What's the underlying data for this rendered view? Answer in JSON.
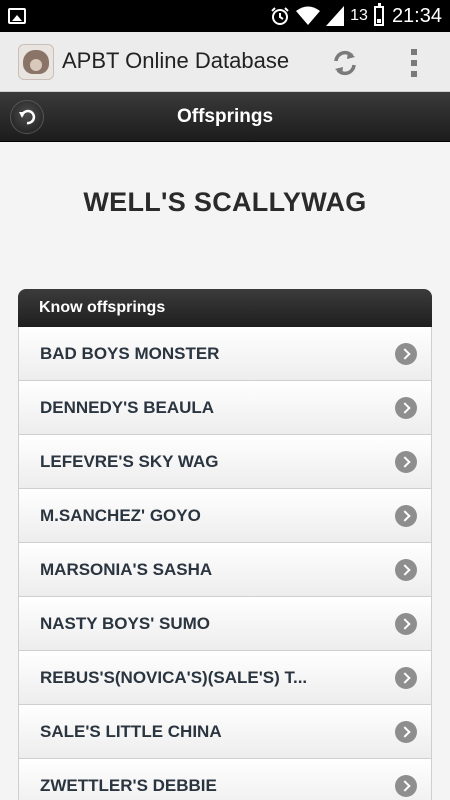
{
  "status_bar": {
    "signal_number": "13",
    "time": "21:34"
  },
  "action_bar": {
    "title": "APBT Online Database"
  },
  "header": {
    "title": "Offsprings"
  },
  "dog": {
    "name": "WELL'S SCALLYWAG"
  },
  "offsprings": {
    "header": "Know offsprings",
    "items": [
      "BAD BOYS MONSTER",
      "DENNEDY'S BEAULA",
      "LEFEVRE'S SKY WAG",
      "M.SANCHEZ' GOYO",
      "MARSONIA'S SASHA",
      "NASTY BOYS' SUMO",
      "REBUS'S(NOVICA'S)(SALE'S) T...",
      "SALE'S LITTLE CHINA",
      "ZWETTLER'S DEBBIE"
    ]
  }
}
